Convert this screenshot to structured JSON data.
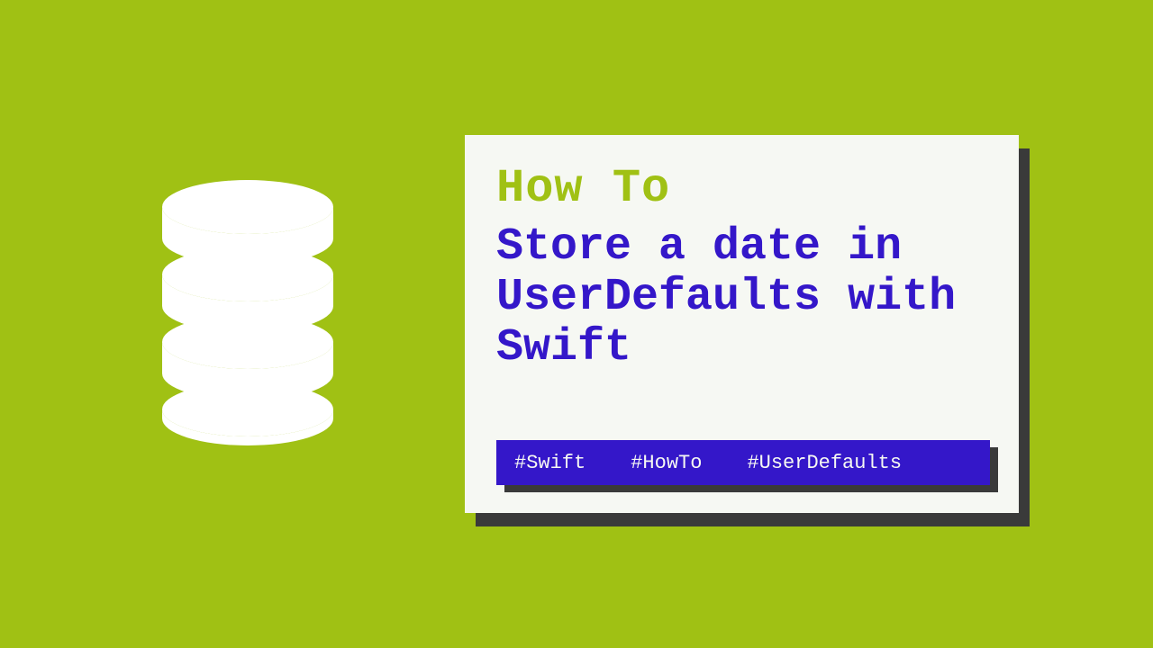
{
  "howToLabel": "How To",
  "title": "Store a date in UserDefaults with Swift",
  "tags": {
    "tag1": "#Swift",
    "tag2": "#HowTo",
    "tag3": "#UserDefaults"
  }
}
